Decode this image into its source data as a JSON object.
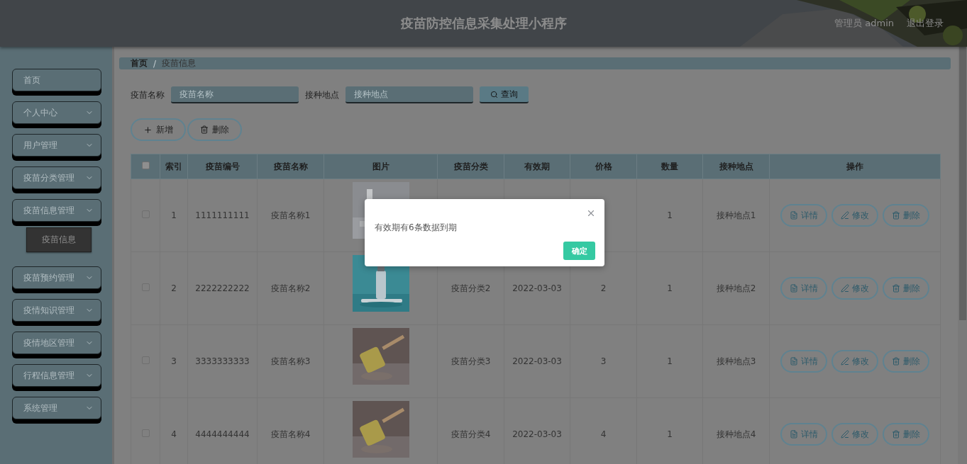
{
  "header": {
    "title": "疫苗防控信息采集处理小程序",
    "user": "管理员 admin",
    "logout": "退出登录",
    "background": {
      "kind": "picture"
    }
  },
  "sidebar": {
    "items": [
      {
        "label": "首页",
        "kind": "link"
      },
      {
        "label": "个人中心",
        "kind": "menu"
      },
      {
        "label": "用户管理",
        "kind": "menu"
      },
      {
        "label": "疫苗分类管理",
        "kind": "menu"
      },
      {
        "label": "疫苗信息管理",
        "kind": "menu",
        "children": [
          {
            "label": "疫苗信息",
            "selected": true
          }
        ]
      },
      {
        "label": "疫苗预约管理",
        "kind": "menu"
      },
      {
        "label": "疫情知识管理",
        "kind": "menu"
      },
      {
        "label": "疫情地区管理",
        "kind": "menu"
      },
      {
        "label": "行程信息管理",
        "kind": "menu"
      },
      {
        "label": "系统管理",
        "kind": "menu"
      }
    ]
  },
  "breadcrumb": {
    "items": [
      "首页",
      "疫苗信息"
    ],
    "separator": "/"
  },
  "search": {
    "fields": [
      {
        "label": "疫苗名称",
        "placeholder": "疫苗名称"
      },
      {
        "label": "接种地点",
        "placeholder": "接种地点"
      }
    ],
    "button": "查询"
  },
  "actions": [
    {
      "kind": "add",
      "label": "新增"
    },
    {
      "kind": "delete",
      "label": "删除"
    }
  ],
  "table": {
    "columns": [
      "索引",
      "疫苗编号",
      "疫苗名称",
      "图片",
      "疫苗分类",
      "有效期",
      "价格",
      "数量",
      "接种地点",
      "操作"
    ],
    "header_checked": false,
    "rows": [
      {
        "checked": false,
        "index": "1",
        "code": "1111111111",
        "name": "疫苗名称1",
        "image": {
          "kind": "picture"
        },
        "category": null,
        "expiry": null,
        "price": null,
        "quantity": "1",
        "location": "接种地点1",
        "actions": [
          {
            "kind": "detail",
            "label": "详情"
          },
          {
            "kind": "edit",
            "label": "修改"
          },
          {
            "kind": "delete",
            "label": "删除"
          }
        ]
      },
      {
        "checked": false,
        "index": "2",
        "code": "2222222222",
        "name": "疫苗名称2",
        "image": {
          "kind": "picture"
        },
        "category": "疫苗分类2",
        "expiry": "2022-03-03",
        "price": "2",
        "quantity": "1",
        "location": "接种地点2",
        "actions": [
          {
            "kind": "detail",
            "label": "详情"
          },
          {
            "kind": "edit",
            "label": "修改"
          },
          {
            "kind": "delete",
            "label": "删除"
          }
        ]
      },
      {
        "checked": false,
        "index": "3",
        "code": "3333333333",
        "name": "疫苗名称3",
        "image": {
          "kind": "picture"
        },
        "category": "疫苗分类3",
        "expiry": "2022-03-03",
        "price": "3",
        "quantity": "1",
        "location": "接种地点3",
        "actions": [
          {
            "kind": "detail",
            "label": "详情"
          },
          {
            "kind": "edit",
            "label": "修改"
          },
          {
            "kind": "delete",
            "label": "删除"
          }
        ]
      },
      {
        "checked": false,
        "index": "4",
        "code": "4444444444",
        "name": "疫苗名称4",
        "image": {
          "kind": "picture"
        },
        "category": "疫苗分类4",
        "expiry": "2022-03-03",
        "price": "4",
        "quantity": "1",
        "location": "接种地点4",
        "actions": [
          {
            "kind": "detail",
            "label": "详情"
          },
          {
            "kind": "edit",
            "label": "修改"
          },
          {
            "kind": "delete",
            "label": "删除"
          }
        ]
      }
    ]
  },
  "dialog": {
    "message": "有效期有6条数据到期",
    "confirm": "确定"
  }
}
